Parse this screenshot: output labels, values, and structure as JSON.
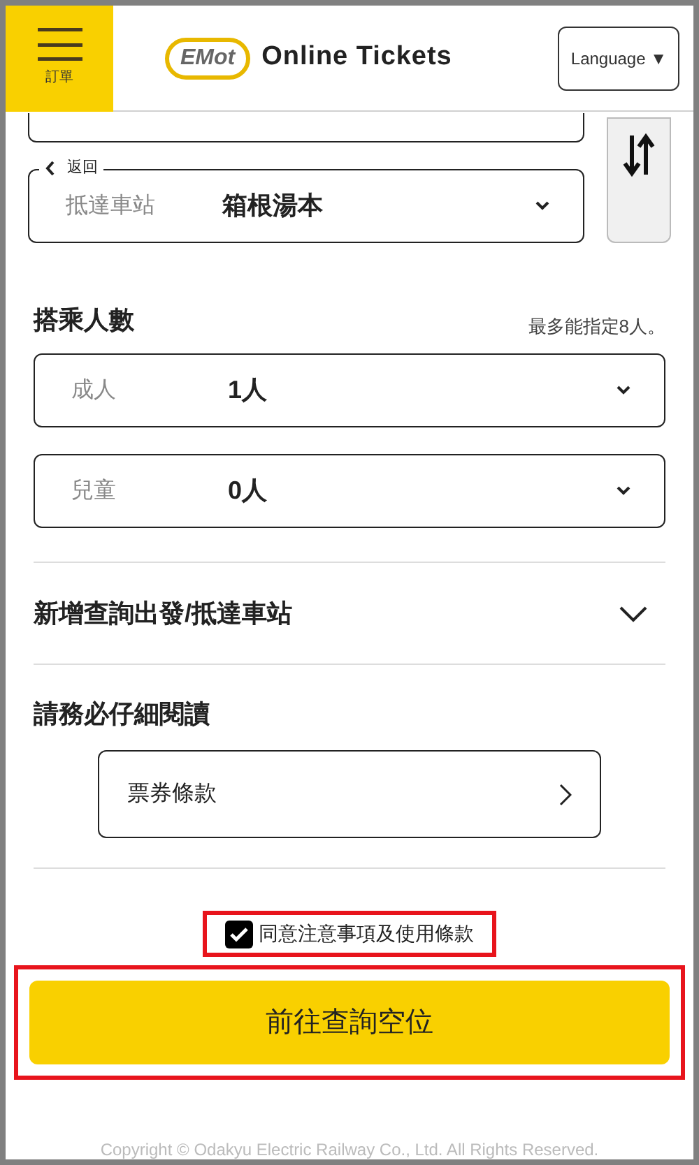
{
  "header": {
    "menu_label": "訂單",
    "logo": "EMot",
    "title": "Online Tickets",
    "language_button": "Language ▼"
  },
  "route": {
    "back_label": "返回",
    "arrival": {
      "label": "抵達車站",
      "value": "箱根湯本"
    }
  },
  "passengers": {
    "title": "搭乘人數",
    "note": "最多能指定8人。",
    "fields": [
      {
        "label": "成人",
        "value": "1人"
      },
      {
        "label": "兒童",
        "value": "0人"
      }
    ]
  },
  "add_station": {
    "label": "新增查詢出發/抵達車站",
    "expanded": false
  },
  "must_read": {
    "title": "請務必仔細閱讀",
    "terms_button": "票券條款"
  },
  "agree": {
    "label": "同意注意事項及使用條款",
    "checked": true,
    "highlighted": true
  },
  "submit": {
    "label": "前往查詢空位",
    "highlighted": true
  },
  "footer": {
    "copyright": "Copyright © Odakyu Electric Railway Co., Ltd. All Rights Reserved."
  }
}
